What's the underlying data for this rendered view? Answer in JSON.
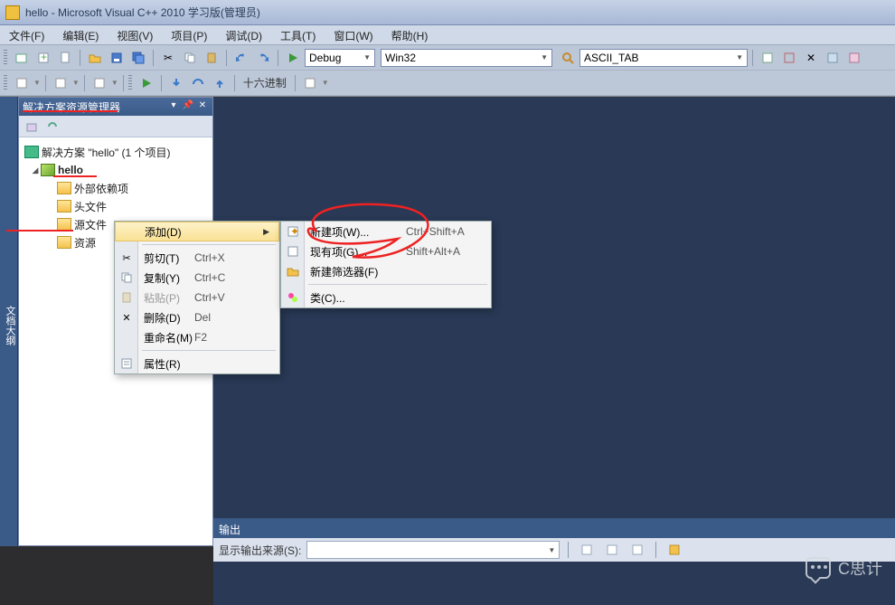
{
  "title": "hello - Microsoft Visual C++ 2010 学习版(管理员)",
  "menus": [
    "文件(F)",
    "编辑(E)",
    "视图(V)",
    "项目(P)",
    "调试(D)",
    "工具(T)",
    "窗口(W)",
    "帮助(H)"
  ],
  "toolbar1": {
    "config_combo": "Debug",
    "platform_combo": "Win32",
    "search_combo": "ASCII_TAB"
  },
  "toolbar2": {
    "hex_label": "十六进制"
  },
  "side_tab": "文档大纲",
  "solution_explorer": {
    "title": "解决方案资源管理器",
    "solution_line": "解决方案 \"hello\" (1 个项目)",
    "project": "hello",
    "nodes": [
      "外部依赖项",
      "头文件",
      "源文件",
      "资源"
    ]
  },
  "context_menu": {
    "items": [
      {
        "label": "添加(D)",
        "accel": "",
        "hi": true,
        "sub": true
      },
      {
        "label": "剪切(T)",
        "accel": "Ctrl+X",
        "icon": "cut"
      },
      {
        "label": "复制(Y)",
        "accel": "Ctrl+C",
        "icon": "copy"
      },
      {
        "label": "粘贴(P)",
        "accel": "Ctrl+V",
        "icon": "paste",
        "disabled": true
      },
      {
        "label": "删除(D)",
        "accel": "Del",
        "icon": "delete"
      },
      {
        "label": "重命名(M)",
        "accel": "F2"
      },
      {
        "label": "属性(R)",
        "icon": "props"
      }
    ]
  },
  "sub_menu": {
    "items": [
      {
        "label": "新建项(W)...",
        "accel": "Ctrl+Shift+A",
        "icon": "newitem"
      },
      {
        "label": "现有项(G)...",
        "accel": "Shift+Alt+A",
        "icon": "existing"
      },
      {
        "label": "新建筛选器(F)",
        "icon": "filter"
      },
      {
        "label": "类(C)...",
        "icon": "class"
      }
    ]
  },
  "output": {
    "title": "输出",
    "show_label": "显示输出来源(S):"
  },
  "watermark": "C思计"
}
